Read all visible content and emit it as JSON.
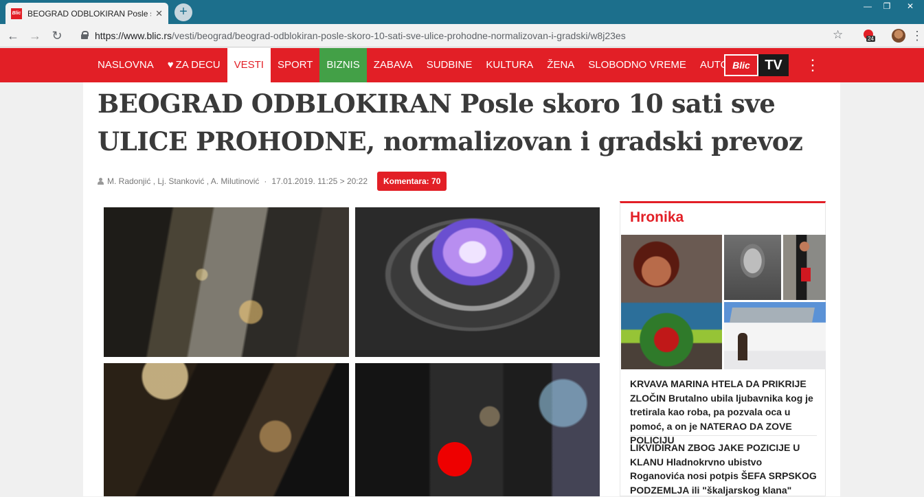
{
  "browser": {
    "tab_title": "BEOGRAD ODBLOKIRAN Posle skoro",
    "tab_favicon_text": "Blic",
    "tab_close": "✕",
    "new_tab": "+",
    "url_host": "https://www.blic.rs",
    "url_path": "/vesti/beograd/beograd-odblokiran-posle-skoro-10-sati-sve-ulice-prohodne-normalizovan-i-gradski/w8j23es",
    "extension_badge": "24",
    "window_controls": {
      "minimize": "—",
      "restore": "❐",
      "close": "✕"
    },
    "icons": [
      "back-icon",
      "forward-icon",
      "reload-icon",
      "lock-icon",
      "star-icon",
      "menu-icon"
    ]
  },
  "nav": {
    "items": [
      {
        "label": "NASLOVNA"
      },
      {
        "label": "ZA DECU"
      },
      {
        "label": "VESTI"
      },
      {
        "label": "SPORT"
      },
      {
        "label": "BIZNIS"
      },
      {
        "label": "ZABAVA"
      },
      {
        "label": "SUDBINE"
      },
      {
        "label": "KULTURA"
      },
      {
        "label": "ŽENA"
      },
      {
        "label": "SLOBODNO VREME"
      },
      {
        "label": "AUTO"
      }
    ],
    "logo_text": "Blic",
    "tv_label": "TV",
    "colors": {
      "brand_red": "#e21f26",
      "biznis_green": "#43a047"
    }
  },
  "article": {
    "headline": "BEOGRAD ODBLOKIRAN Posle skoro 10 sati sve ULICE PROHODNE, normalizovan i gradski prevoz",
    "authors": "M. Radonjić , Lj. Stanković , A. Milutinović",
    "separator": "·",
    "date": "17.01.2019. 11:25 > 20:22",
    "comments_label": "Komentara: 70"
  },
  "sidebar": {
    "title": "Hronika",
    "stories": [
      {
        "text": "KRVAVA MARINA HTELA DA PRIKRIJE ZLOČIN Brutalno ubila ljubavnika kog je tretirala kao roba, pa pozvala oca u pomoć, a on je NATERAO DA ZOVE POLICIJU"
      },
      {
        "text": "LIKVIDIRAN ZBOG JAKE POZICIJE U KLANU Hladnokrvno ubistvo Roganovića nosi potpis ŠEFA SRPSKOG PODZEMLJA ili \"škaljarskog klana\""
      }
    ]
  }
}
